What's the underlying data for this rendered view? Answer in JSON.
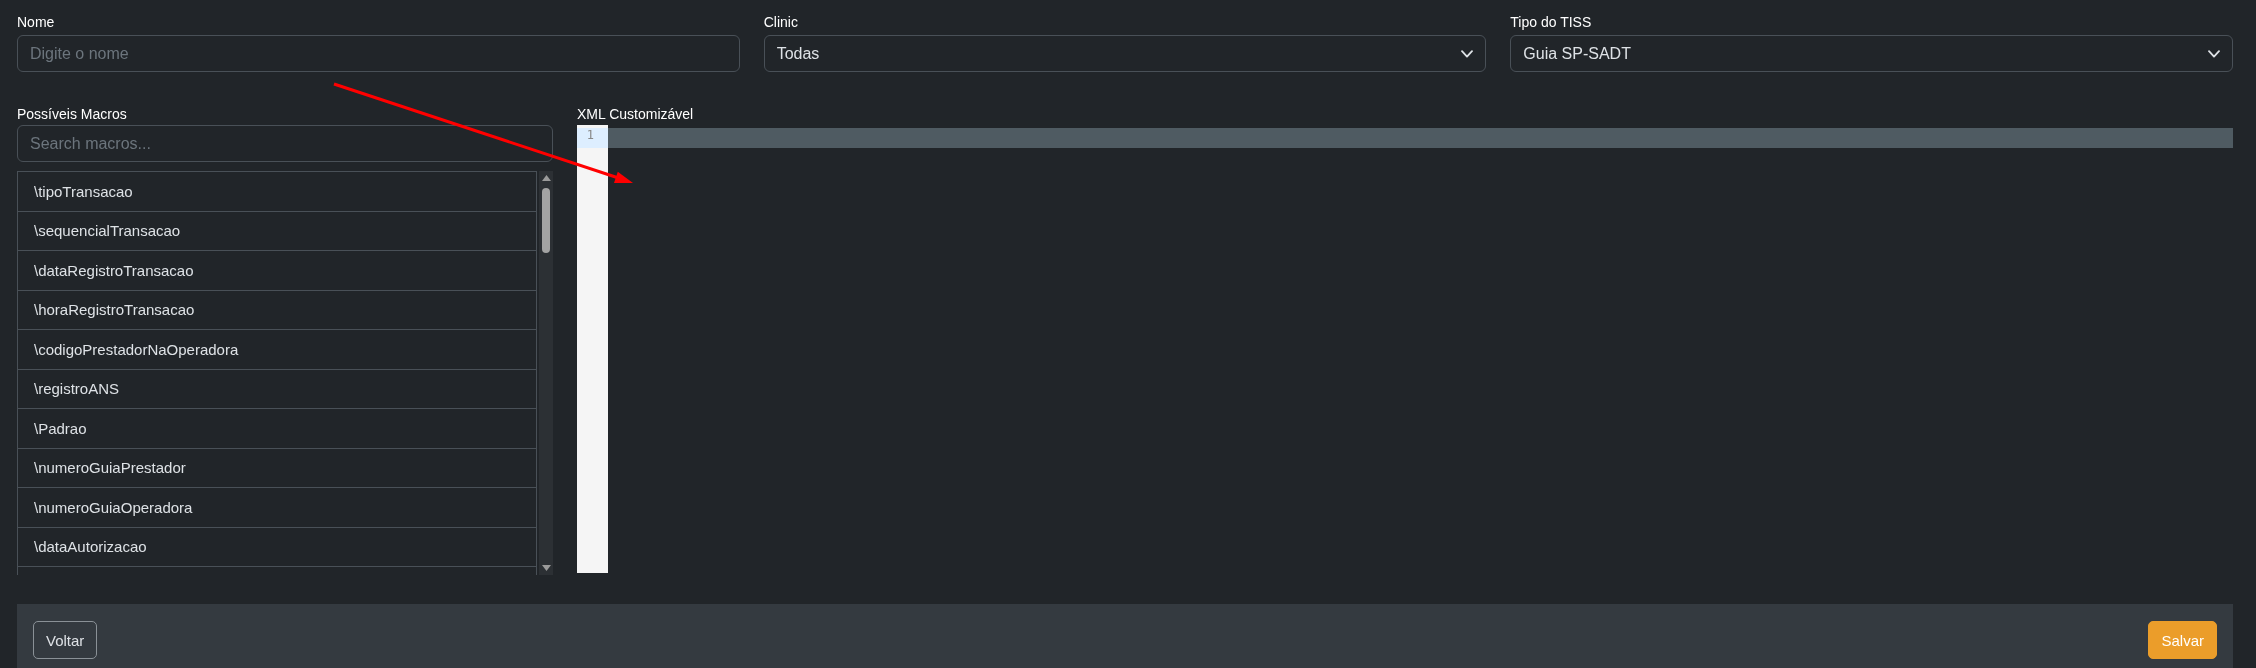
{
  "form": {
    "fields": [
      {
        "kind": "input",
        "label": "Nome",
        "placeholder": "Digite o nome"
      },
      {
        "kind": "select",
        "label": "Clinic",
        "value": "Todas"
      },
      {
        "kind": "select",
        "label": "Tipo do TISS",
        "value": "Guia SP-SADT"
      }
    ]
  },
  "macros": {
    "label": "Possíveis Macros",
    "search": {
      "placeholder": "Search macros..."
    },
    "items": [
      "\\tipoTransacao",
      "\\sequencialTransacao",
      "\\dataRegistroTransacao",
      "\\horaRegistroTransacao",
      "\\codigoPrestadorNaOperadora",
      "\\registroANS",
      "\\Padrao",
      "\\numeroGuiaPrestador",
      "\\numeroGuiaOperadora",
      "\\dataAutorizacao"
    ]
  },
  "editor": {
    "label": "XML Customizável",
    "lines": [
      {
        "number": "1",
        "active": true
      }
    ]
  },
  "footer": {
    "buttons": [
      {
        "kind": "secondary",
        "label": "Voltar"
      },
      {
        "kind": "primary",
        "label": "Salvar"
      }
    ]
  }
}
